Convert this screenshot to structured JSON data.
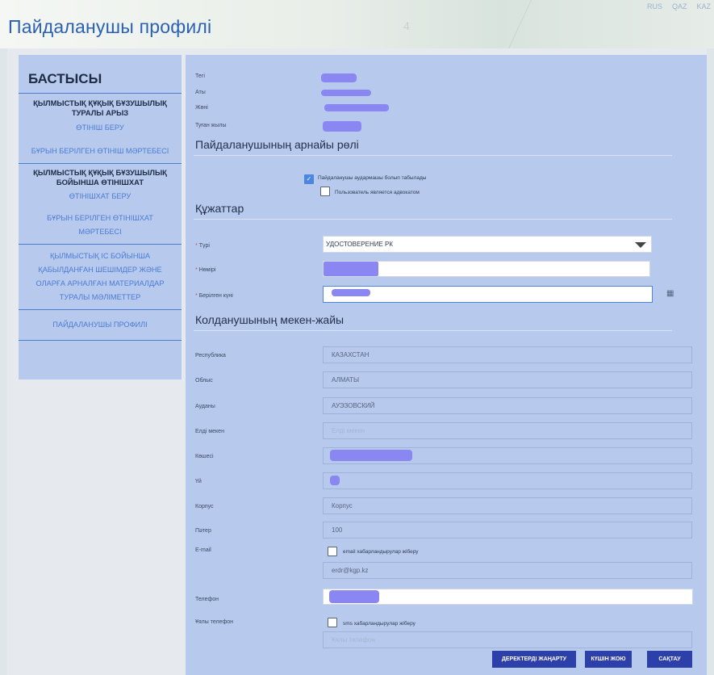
{
  "header": {
    "title": "Пайдаланушы профилі",
    "languages": [
      "RUS",
      "QAZ",
      "KAZ"
    ]
  },
  "sidebar": {
    "heading": "БАСТЫСЫ",
    "section1": "ҚЫЛМЫСТЫҚ ҚҰҚЫҚ БҰЗУШЫЛЫҚ ТУРАЛЫ АРЫЗ",
    "section1_links": [
      "ӨТІНІШ БЕРУ",
      "БҰРЫН БЕРІЛГЕН ӨТІНІШ МӘРТЕБЕСІ"
    ],
    "section2": "ҚЫЛМЫСТЫҚ ҚҰҚЫҚ БҰЗУШЫЛЫҚ БОЙЫНША ӨТІНІШХАТ",
    "section2_links": [
      "ӨТІНІШХАТ БЕРУ",
      "БҰРЫН БЕРІЛГЕН ӨТІНІШХАТ МӘРТЕБЕСІ"
    ],
    "link_decisions": "ҚЫЛМЫСТЫҚ ІС БОЙЫНША ҚАБЫЛДАНҒАН ШЕШІМДЕР ЖӘНЕ ОЛАРҒА АРНАЛҒАН МАТЕРИАЛДАР ТУРАЛЫ МӘЛІМЕТТЕР",
    "link_profile": "ПАЙДАЛАНУШЫ ПРОФИЛІ"
  },
  "personal": {
    "surname_label": "Тегі",
    "name_label": "Аты",
    "patronymic_label": "Жөні",
    "birth_year_label": "Туған жылы"
  },
  "role": {
    "title": "Пайдаланушының арнайы рөлі",
    "translator_label": "Пайдаланушы аудармашы болып табылады",
    "translator_checked": true,
    "lawyer_label": "Пользователь является адвокатом",
    "lawyer_checked": false
  },
  "documents": {
    "title": "Құжаттар",
    "type_label": "Түрі",
    "type_value": "УДОСТОВЕРЕНИЕ РК",
    "number_label": "Нөмірі",
    "issue_date_label": "Берілген күні",
    "required_mark": "*"
  },
  "address": {
    "title": "Колданушының мекен-жайы",
    "republic_label": "Республика",
    "republic_value": "КАЗАХСТАН",
    "region_label": "Облыс",
    "region_value": "АЛМАТЫ",
    "district_label": "Ауданы",
    "district_value": "АУЭЗОВСКИЙ",
    "settlement_label": "Елді мекен",
    "settlement_placeholder": "Елді мекен",
    "street_label": "Көшесі",
    "house_label": "Үй",
    "building_label": "Корпус",
    "building_placeholder": "Корпус",
    "apartment_label": "Пәтер",
    "apartment_value": "100",
    "email_label": "E-mail",
    "email_notify_label": "email хабарландырулар жіберу",
    "email_value": "erdr@kgp.kz",
    "phone_label": "Телефон",
    "mobile_label": "Ұялы телефон",
    "sms_notify_label": "sms хабарландырулар жіберу",
    "mobile_placeholder": "Ұялы телефон"
  },
  "buttons": {
    "refresh": "ДЕРЕКТЕРДІ ЖАҢАРТУ",
    "cancel": "КҮШІН ЖОЮ",
    "save": "САҚТАУ"
  },
  "colors": {
    "accent": "#2b60b5",
    "button": "#2d3fa8",
    "panel": "#b7caed",
    "redaction": "#8a86f2"
  }
}
